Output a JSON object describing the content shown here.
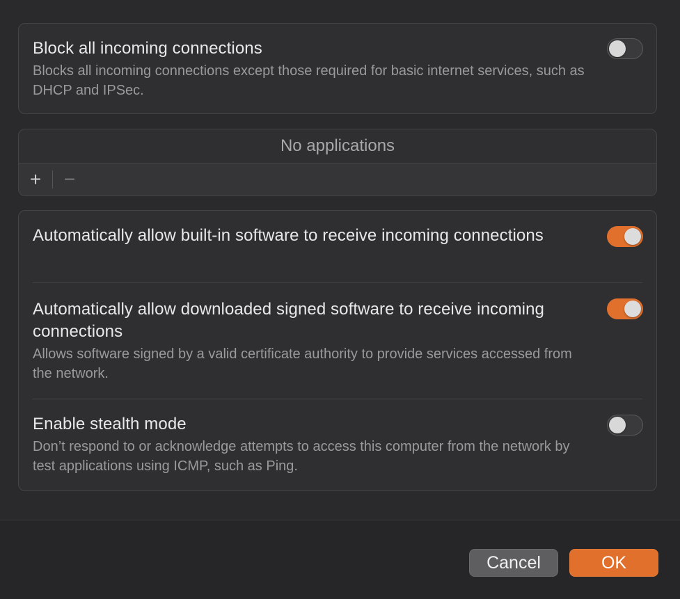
{
  "block_group": {
    "title": "Block all incoming connections",
    "description": "Blocks all incoming connections except those required for basic internet services, such as DHCP and IPSec.",
    "enabled": false
  },
  "apps_group": {
    "empty_text": "No applications",
    "add_symbol": "+",
    "remove_symbol": "−"
  },
  "options_group": {
    "builtin": {
      "title": "Automatically allow built-in software to receive incoming connections",
      "enabled": true
    },
    "signed": {
      "title": "Automatically allow downloaded signed software to receive incoming connections",
      "description": "Allows software signed by a valid certificate authority to provide services accessed from the network.",
      "enabled": true
    },
    "stealth": {
      "title": "Enable stealth mode",
      "description": "Don’t respond to or acknowledge attempts to access this computer from the network by test applications using ICMP, such as Ping.",
      "enabled": false
    }
  },
  "footer": {
    "cancel_label": "Cancel",
    "ok_label": "OK"
  },
  "colors": {
    "accent": "#e0702c",
    "background": "#2a2a2c",
    "group_background": "#2f2f31"
  },
  "icons": {
    "add": "plus-icon",
    "remove": "minus-icon"
  }
}
